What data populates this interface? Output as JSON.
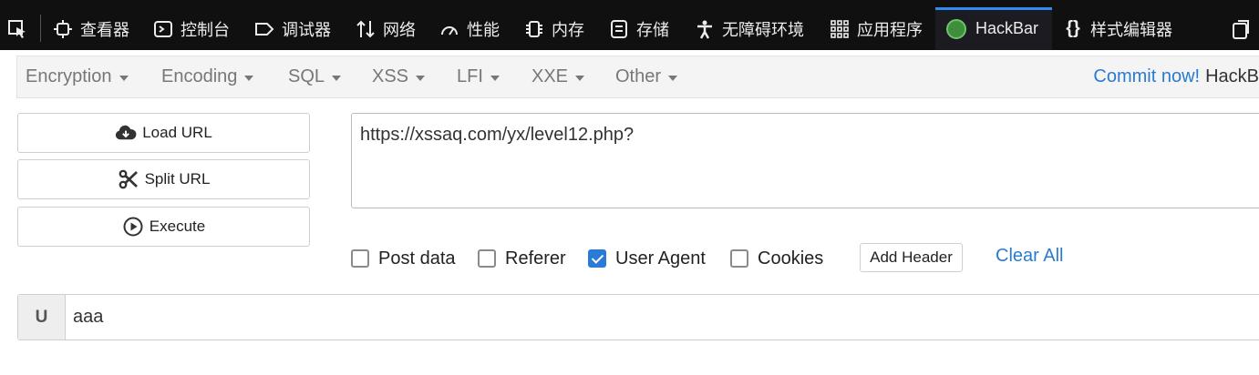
{
  "devtools": {
    "tabs": [
      {
        "label": "查看器",
        "icon": "inspector-icon"
      },
      {
        "label": "控制台",
        "icon": "console-icon"
      },
      {
        "label": "调试器",
        "icon": "debugger-icon"
      },
      {
        "label": "网络",
        "icon": "network-icon"
      },
      {
        "label": "性能",
        "icon": "performance-icon"
      },
      {
        "label": "内存",
        "icon": "memory-icon"
      },
      {
        "label": "存储",
        "icon": "storage-icon"
      },
      {
        "label": "无障碍环境",
        "icon": "accessibility-icon"
      },
      {
        "label": "应用程序",
        "icon": "application-icon"
      },
      {
        "label": "HackBar",
        "icon": "hackbar-icon",
        "active": true
      },
      {
        "label": "样式编辑器",
        "icon": "style-editor-icon"
      }
    ]
  },
  "menubar": {
    "items": [
      "Encryption",
      "Encoding",
      "SQL",
      "XSS",
      "LFI",
      "XXE",
      "Other"
    ],
    "commit_label": "Commit now!",
    "brand": "HackB"
  },
  "actions": {
    "load_url": "Load URL",
    "split_url": "Split URL",
    "execute": "Execute"
  },
  "url": {
    "value": "https://xssaq.com/yx/level12.php?"
  },
  "options": {
    "post_data": {
      "label": "Post data",
      "checked": false
    },
    "referer": {
      "label": "Referer",
      "checked": false
    },
    "user_agent": {
      "label": "User Agent",
      "checked": true
    },
    "cookies": {
      "label": "Cookies",
      "checked": false
    },
    "add_header": "Add Header",
    "clear_all": "Clear All"
  },
  "header_row": {
    "label": "U",
    "value": "aaa"
  },
  "colors": {
    "devtools_bg": "#101011",
    "active_tab_accent": "#2e8cf0",
    "link": "#2a7bd0",
    "checkbox_checked": "#2a7bd8"
  }
}
